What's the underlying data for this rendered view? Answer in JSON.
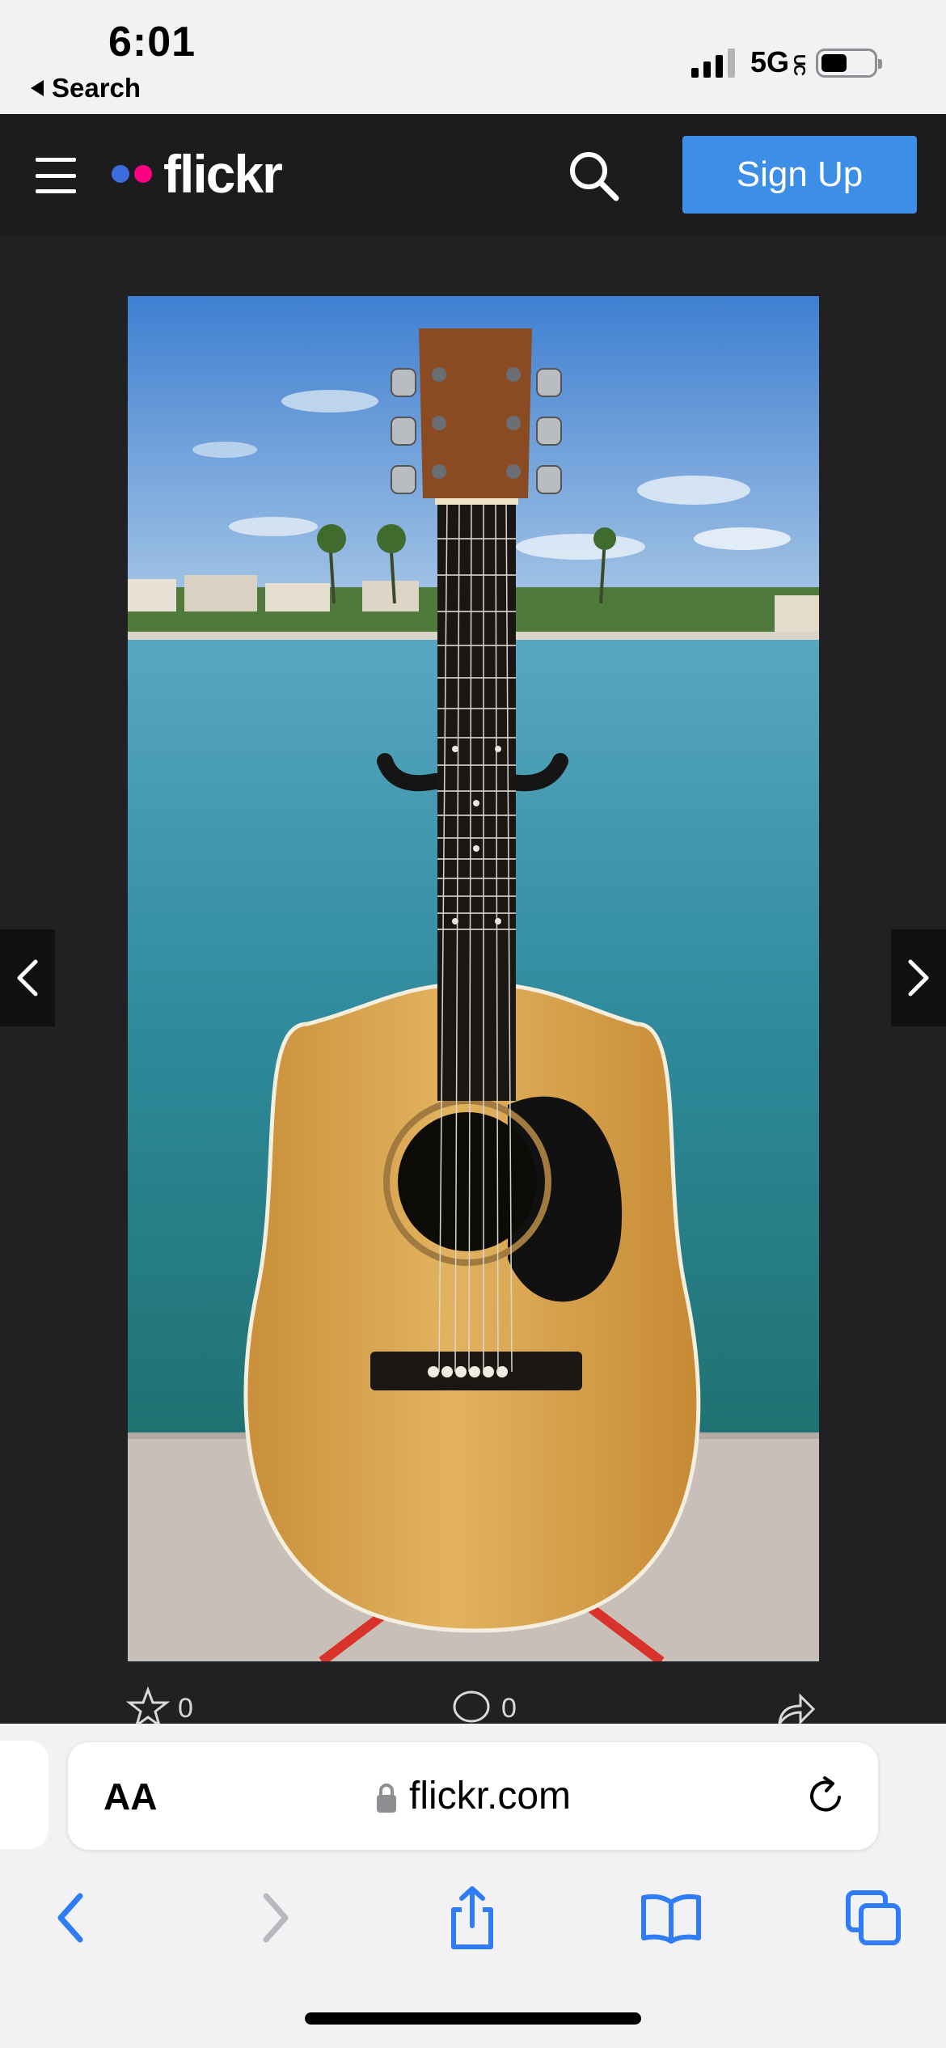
{
  "status_bar": {
    "time": "6:01",
    "back_label": "Search",
    "network": "5G",
    "network_badge": "UC",
    "battery_level": 0.5
  },
  "header": {
    "logo_text": "flickr",
    "logo_colors": [
      "#3b6bdc",
      "#ff0084"
    ],
    "signup_label": "Sign Up",
    "accent": "#3d8ee6"
  },
  "photo": {
    "subject": "acoustic-guitar-on-stand-by-waterfront",
    "likes": "0",
    "comments": "0"
  },
  "browser": {
    "text_size_label": "AA",
    "url": "flickr.com",
    "toolbar_icons": [
      "back-icon",
      "forward-icon",
      "share-icon",
      "bookmarks-icon",
      "tabs-icon"
    ],
    "accent": "#2f7cf6"
  }
}
